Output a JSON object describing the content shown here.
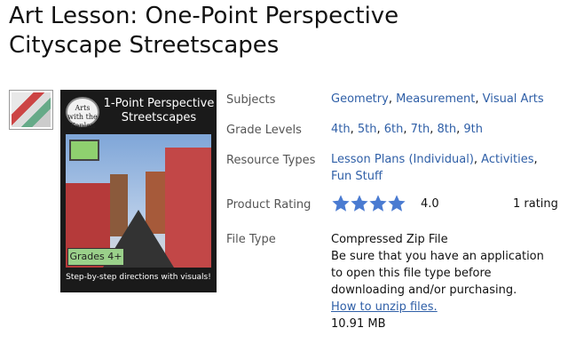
{
  "title_line1": "Art Lesson: One-Point Perspective",
  "title_line2": "Cityscape Streetscapes",
  "cover": {
    "logo_text": "Arts with the Kaplan",
    "title": "1-Point Perspective Streetscapes",
    "grades_label": "Grades 4+",
    "tagline": "Step-by-step directions with visuals!"
  },
  "details": {
    "subjects_label": "Subjects",
    "subjects": [
      "Geometry",
      "Measurement",
      "Visual Arts"
    ],
    "grades_label": "Grade Levels",
    "grades": [
      "4th",
      "5th",
      "6th",
      "7th",
      "8th",
      "9th"
    ],
    "resource_label": "Resource Types",
    "resources": [
      "Lesson Plans (Individual)",
      "Activities",
      "Fun Stuff"
    ],
    "rating_label": "Product Rating",
    "rating_value": "4.0",
    "rating_stars": 4,
    "rating_count": "1 rating",
    "filetype_label": "File Type",
    "filetype": "Compressed Zip File",
    "filetype_note_1": "Be sure that you have an application",
    "filetype_note_2": "to open this file type before",
    "filetype_note_3": "downloading and/or purchasing.",
    "unzip_link": "How to unzip files.",
    "filesize": "10.91 MB"
  },
  "colors": {
    "link": "#2f5fa7",
    "star": "#4a7bd1"
  }
}
